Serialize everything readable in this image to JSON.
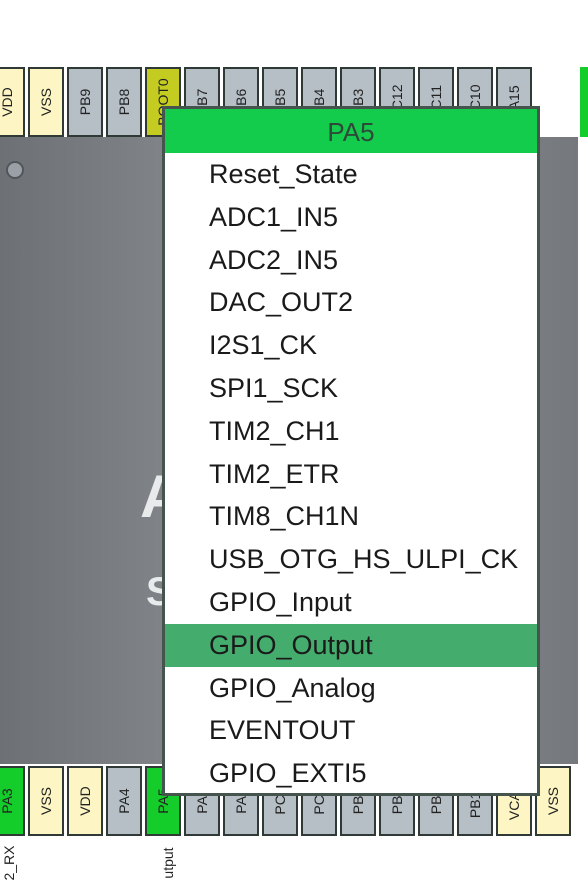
{
  "top_pins": [
    {
      "label": "VDD",
      "color": "#fdf5c4"
    },
    {
      "label": "VSS",
      "color": "#fdf5c4"
    },
    {
      "label": "PB9",
      "color": "#b6bfc6"
    },
    {
      "label": "PB8",
      "color": "#b6bfc6"
    },
    {
      "label": "BOOT0",
      "color": "#c4cc22"
    },
    {
      "label": "PB7",
      "color": "#b6bfc6"
    },
    {
      "label": "PB6",
      "color": "#b6bfc6"
    },
    {
      "label": "PB5",
      "color": "#b6bfc6"
    },
    {
      "label": "PB4",
      "color": "#b6bfc6"
    },
    {
      "label": "PB3",
      "color": "#b6bfc6"
    },
    {
      "label": "PC12",
      "color": "#b6bfc6"
    },
    {
      "label": "PC11",
      "color": "#b6bfc6"
    },
    {
      "label": "PC10",
      "color": "#b6bfc6"
    },
    {
      "label": "PA15",
      "color": "#b6bfc6"
    }
  ],
  "bottom_pins": [
    {
      "label": "PA3",
      "color": "#14cc2a"
    },
    {
      "label": "VSS",
      "color": "#fdf5c4"
    },
    {
      "label": "VDD",
      "color": "#fdf5c4"
    },
    {
      "label": "PA4",
      "color": "#b6bfc6"
    },
    {
      "label": "PA5",
      "color": "#14cc2a"
    },
    {
      "label": "PA6",
      "color": "#b6bfc6"
    },
    {
      "label": "PA7",
      "color": "#b6bfc6"
    },
    {
      "label": "PC4",
      "color": "#b6bfc6"
    },
    {
      "label": "PC5",
      "color": "#b6bfc6"
    },
    {
      "label": "PB0",
      "color": "#b6bfc6"
    },
    {
      "label": "PB1",
      "color": "#b6bfc6"
    },
    {
      "label": "PB2",
      "color": "#b6bfc6"
    },
    {
      "label": "PB10",
      "color": "#b6bfc6"
    },
    {
      "label": "VCAP",
      "color": "#fdf5c4"
    },
    {
      "label": "VSS",
      "color": "#fdf5c4"
    }
  ],
  "pin_captions": {
    "pa3": "2_RX",
    "pa5": "utput"
  },
  "chip_text": {
    "glyph_a": "A",
    "glyph_s": "S"
  },
  "menu": {
    "title": "PA5",
    "selected_index": 11,
    "items": [
      "Reset_State",
      "ADC1_IN5",
      "ADC2_IN5",
      "DAC_OUT2",
      "I2S1_CK",
      "SPI1_SCK",
      "TIM2_CH1",
      "TIM2_ETR",
      "TIM8_CH1N",
      "USB_OTG_HS_ULPI_CK",
      "GPIO_Input",
      "GPIO_Output",
      "GPIO_Analog",
      "EVENTOUT",
      "GPIO_EXTI5"
    ]
  }
}
